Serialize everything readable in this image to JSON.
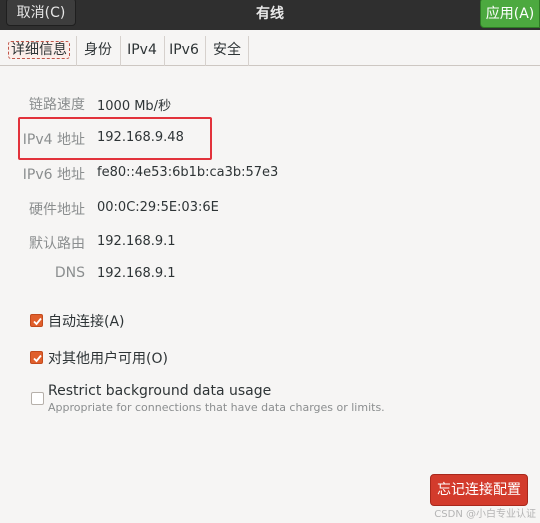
{
  "header": {
    "cancel_label": "取消(C)",
    "title": "有线",
    "apply_label": "应用(A)"
  },
  "tabs": [
    {
      "label": "详细信息",
      "active": true
    },
    {
      "label": "身份"
    },
    {
      "label": "IPv4"
    },
    {
      "label": "IPv6"
    },
    {
      "label": "安全"
    }
  ],
  "details": [
    {
      "label": "链路速度",
      "value": "1000 Mb/秒"
    },
    {
      "label": "IPv4 地址",
      "value": "192.168.9.48"
    },
    {
      "label": "IPv6 地址",
      "value": "fe80::4e53:6b1b:ca3b:57e3"
    },
    {
      "label": "硬件地址",
      "value": "00:0C:29:5E:03:6E"
    },
    {
      "label": "默认路由",
      "value": "192.168.9.1"
    },
    {
      "label": "DNS",
      "value": "192.168.9.1"
    }
  ],
  "options": [
    {
      "label": "自动连接(A)",
      "checked": true
    },
    {
      "label": "对其他用户可用(O)",
      "checked": true
    },
    {
      "label": "Restrict background data usage",
      "sublabel": "Appropriate for connections that have data charges or limits.",
      "checked": false
    }
  ],
  "forget_label": "忘记连接配置",
  "watermark": "CSDN @小白专业认证",
  "colors": {
    "apply": "#4ca93f",
    "checkbox_on": "#e05f2c",
    "forget": "#d33b2c",
    "highlight": "#e2323b"
  }
}
